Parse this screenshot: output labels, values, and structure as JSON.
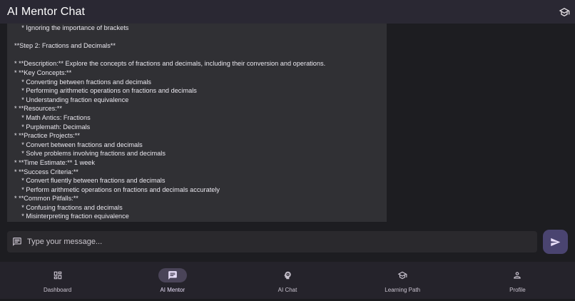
{
  "appbar": {
    "title": "AI Mentor Chat",
    "icon": "school-icon"
  },
  "message": {
    "lines": [
      "    * Ignoring the importance of brackets",
      "",
      "**Step 2: Fractions and Decimals**",
      "",
      "* **Description:** Explore the concepts of fractions and decimals, including their conversion and operations.",
      "* **Key Concepts:**",
      "    * Converting between fractions and decimals",
      "    * Performing arithmetic operations on fractions and decimals",
      "    * Understanding fraction equivalence",
      "* **Resources:**",
      "    * Math Antics: Fractions",
      "    * Purplemath: Decimals",
      "* **Practice Projects:**",
      "    * Convert between fractions and decimals",
      "    * Solve problems involving fractions and decimals",
      "* **Time Estimate:** 1 week",
      "* **Success Criteria:**",
      "    * Convert fluently between fractions and decimals",
      "    * Perform arithmetic operations on fractions and decimals accurately",
      "* **Common Pitfalls:**",
      "    * Confusing fractions and decimals",
      "    * Misinterpreting fraction equivalence"
    ]
  },
  "composer": {
    "placeholder": "Type your message...",
    "value": "",
    "icon": "chat-bubble-icon",
    "send_icon": "send-icon"
  },
  "nav": {
    "items": [
      {
        "label": "Dashboard",
        "icon": "dashboard-icon",
        "active": false
      },
      {
        "label": "AI Mentor",
        "icon": "chat-icon",
        "active": true
      },
      {
        "label": "AI Chat",
        "icon": "psychology-icon",
        "active": false
      },
      {
        "label": "Learning Path",
        "icon": "school-icon",
        "active": false
      },
      {
        "label": "Profile",
        "icon": "person-icon",
        "active": false
      }
    ]
  },
  "colors": {
    "accent": "#4a4470",
    "active_pill": "#4a4458",
    "appbar": "#2a2833",
    "bubble": "#303034"
  }
}
